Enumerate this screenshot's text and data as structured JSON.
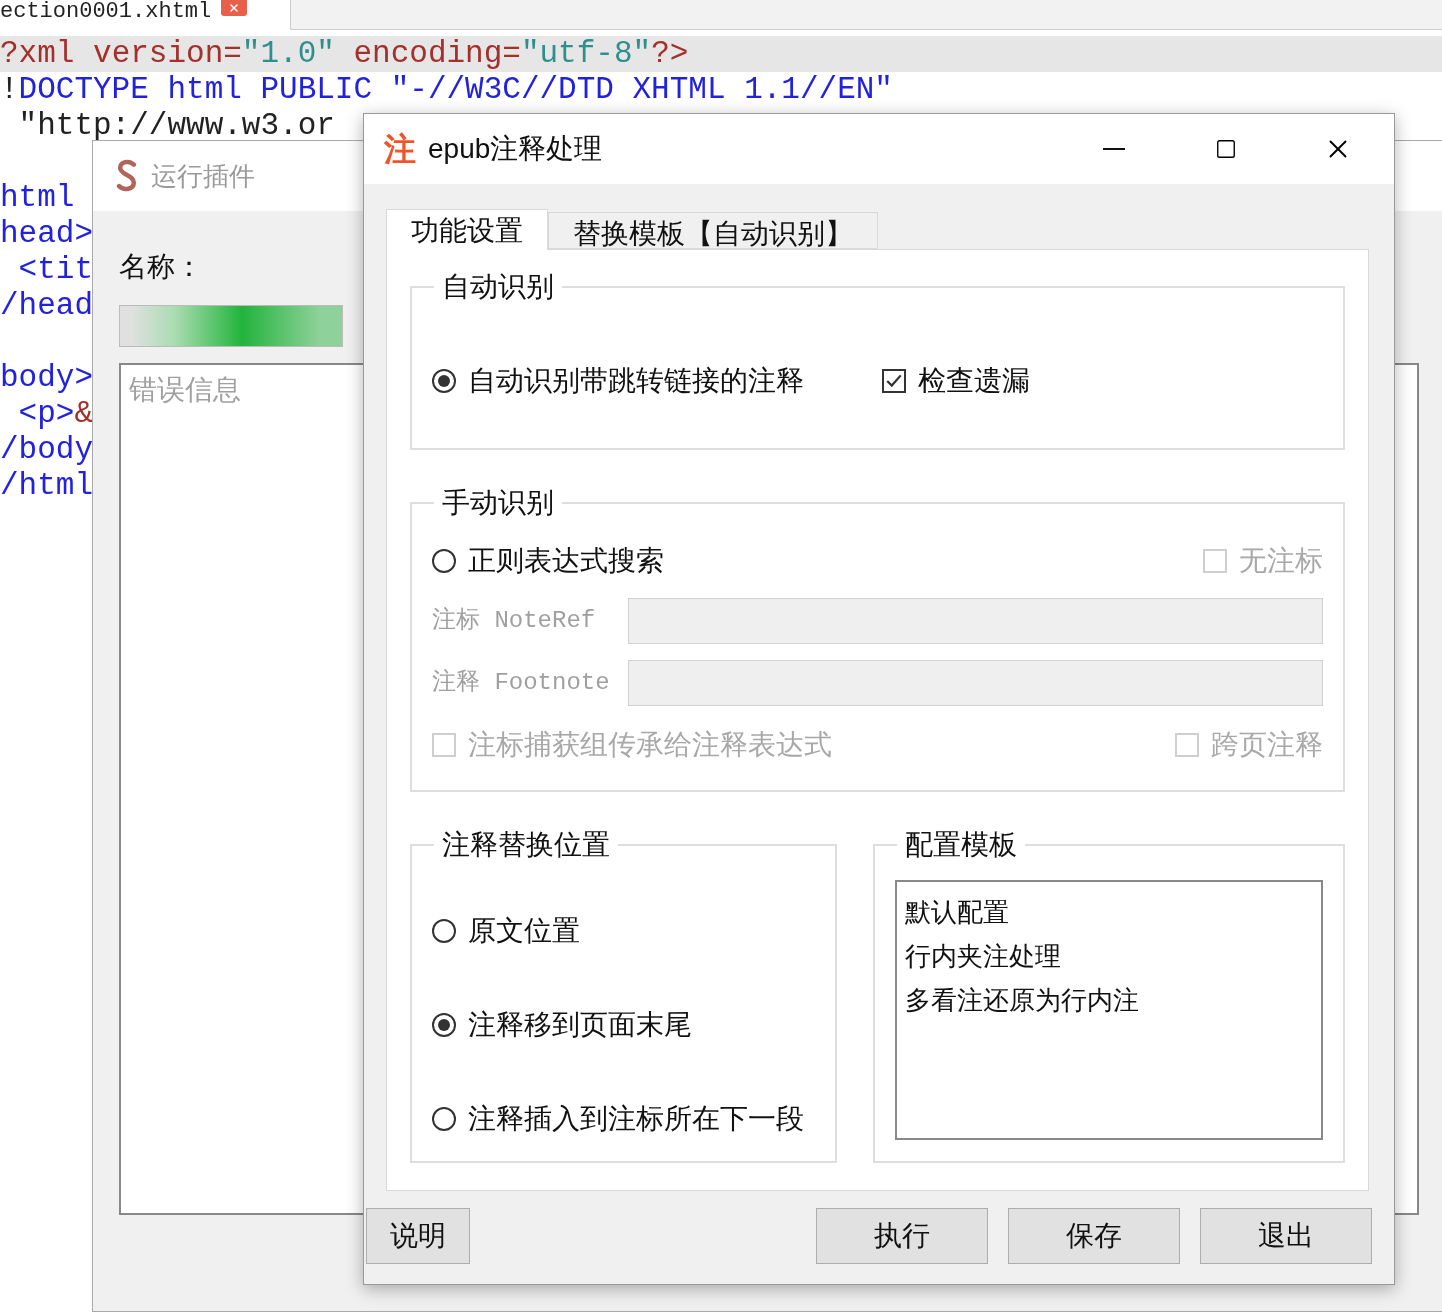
{
  "editor": {
    "tab": {
      "label": "ection0001.xhtml"
    },
    "lines": [
      {
        "highlighted": true,
        "gap_before": false,
        "segments": [
          {
            "text": "?xml",
            "kind": "pi"
          },
          {
            "text": " version=",
            "kind": "pi"
          },
          {
            "text": "\"1.0\"",
            "kind": "str"
          },
          {
            "text": " encoding=",
            "kind": "pi"
          },
          {
            "text": "\"utf-8\"",
            "kind": "str"
          },
          {
            "text": "?>",
            "kind": "pi"
          }
        ]
      },
      {
        "highlighted": false,
        "gap_before": false,
        "segments": [
          {
            "text": "!",
            "kind": "text"
          },
          {
            "text": "DOCTYPE html PUBLIC \"-//W3C//DTD XHTML 1.1//EN\"",
            "kind": "tag"
          }
        ]
      },
      {
        "highlighted": false,
        "gap_before": false,
        "segments": [
          {
            "text": " \"http://www.w3.or",
            "kind": "text"
          }
        ]
      },
      {
        "highlighted": false,
        "gap_before": true,
        "segments": [
          {
            "text": "html",
            "kind": "tag"
          }
        ]
      },
      {
        "highlighted": false,
        "gap_before": false,
        "segments": [
          {
            "text": "head>",
            "kind": "tag"
          }
        ]
      },
      {
        "highlighted": false,
        "gap_before": false,
        "segments": [
          {
            "text": " <tit",
            "kind": "tag"
          }
        ]
      },
      {
        "highlighted": false,
        "gap_before": false,
        "segments": [
          {
            "text": "/head",
            "kind": "tag"
          }
        ]
      },
      {
        "highlighted": false,
        "gap_before": true,
        "segments": [
          {
            "text": "body>",
            "kind": "tag"
          }
        ]
      },
      {
        "highlighted": false,
        "gap_before": false,
        "segments": [
          {
            "text": " <p>",
            "kind": "tag"
          },
          {
            "text": "&",
            "kind": "pi"
          }
        ]
      },
      {
        "highlighted": false,
        "gap_before": false,
        "segments": [
          {
            "text": "/body",
            "kind": "tag"
          }
        ]
      },
      {
        "highlighted": false,
        "gap_before": false,
        "segments": [
          {
            "text": "/html",
            "kind": "tag"
          }
        ]
      }
    ]
  },
  "plugin_window": {
    "title": "运行插件",
    "name_label": "名称：",
    "progress": {
      "level": 1
    },
    "error_box": {
      "placeholder": "错误信息"
    }
  },
  "dialog": {
    "title": "epub注释处理",
    "icon_text": "注",
    "tabs": [
      {
        "label": "功能设置",
        "selected": true
      },
      {
        "label": "替换模板【自动识别】",
        "selected": false
      }
    ],
    "auto_group": {
      "title": "自动识别",
      "options": [
        {
          "kind": "radio",
          "label": "自动识别带跳转链接的注释",
          "selected": true
        },
        {
          "kind": "checkbox",
          "label": "检查遗漏",
          "checked": true
        }
      ]
    },
    "manual_group": {
      "title": "手动识别",
      "regex_option": {
        "label": "正则表达式搜索",
        "selected": false
      },
      "no_ref_option": {
        "label": "无注标",
        "checked": false,
        "disabled": true
      },
      "fields": [
        {
          "label": "注标 NoteRef",
          "disabled": true
        },
        {
          "label": "注释 Footnote",
          "disabled": true
        }
      ],
      "bottom_options": [
        {
          "label": "注标捕获组传承给注释表达式",
          "checked": false,
          "disabled": true
        },
        {
          "label": "跨页注释",
          "checked": false,
          "disabled": true
        }
      ]
    },
    "position_group": {
      "title": "注释替换位置",
      "options": [
        {
          "label": "原文位置",
          "selected": false
        },
        {
          "label": "注释移到页面末尾",
          "selected": true
        },
        {
          "label": "注释插入到注标所在下一段",
          "selected": false
        }
      ]
    },
    "template_group": {
      "title": "配置模板",
      "items": [
        {
          "label": "默认配置"
        },
        {
          "label": "行内夹注处理"
        },
        {
          "label": "多看注还原为行内注"
        }
      ]
    },
    "buttons": [
      {
        "label": "说明"
      },
      {
        "label": "执行"
      },
      {
        "label": "保存"
      },
      {
        "label": "退出"
      }
    ]
  }
}
